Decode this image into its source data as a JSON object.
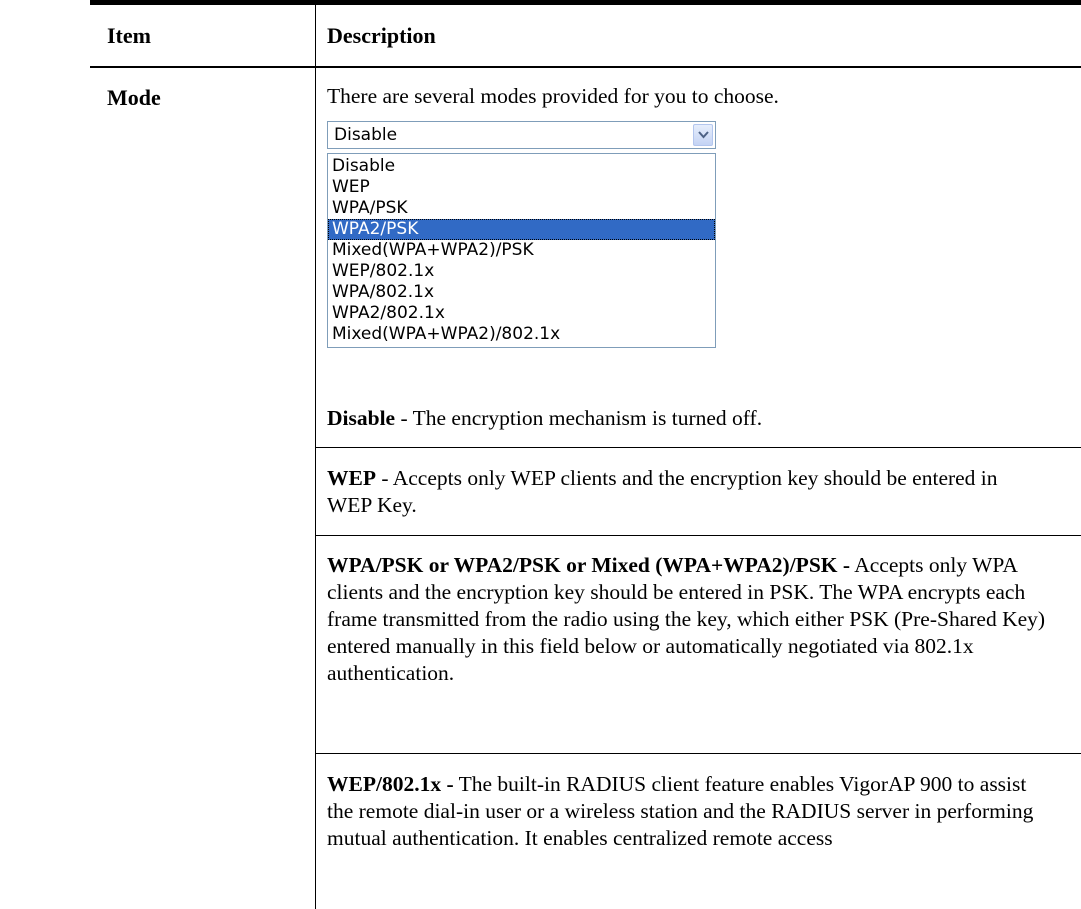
{
  "table": {
    "header_item": "Item",
    "header_description": "Description"
  },
  "row": {
    "item": "Mode",
    "intro": "There are several modes provided for you to choose.",
    "select": {
      "value": "Disable",
      "options": [
        "Disable",
        "WEP",
        "WPA/PSK",
        "WPA2/PSK",
        "Mixed(WPA+WPA2)/PSK",
        "WEP/802.1x",
        "WPA/802.1x",
        "WPA2/802.1x",
        "Mixed(WPA+WPA2)/802.1x"
      ],
      "highlighted": "WPA2/PSK"
    },
    "paragraphs": [
      {
        "term": "Disable",
        "text": " - The encryption mechanism is turned off."
      },
      {
        "term": "WEP",
        "text": " - Accepts only WEP clients and the encryption key should be entered in WEP Key."
      },
      {
        "term": "WPA/PSK or WPA2/PSK or Mixed (WPA+WPA2)/PSK -",
        "text": " Accepts only WPA clients and the encryption key should be entered in PSK. The WPA encrypts each frame transmitted from the radio using the key, which either PSK (Pre-Shared Key) entered manually in this field below or automatically negotiated via 802.1x authentication."
      },
      {
        "term": "WEP/802.1x -",
        "text": " The built-in RADIUS client feature enables VigorAP 900 to assist the remote dial-in user or a wireless station and the RADIUS server in performing mutual authentication. It enables centralized remote access"
      }
    ]
  }
}
